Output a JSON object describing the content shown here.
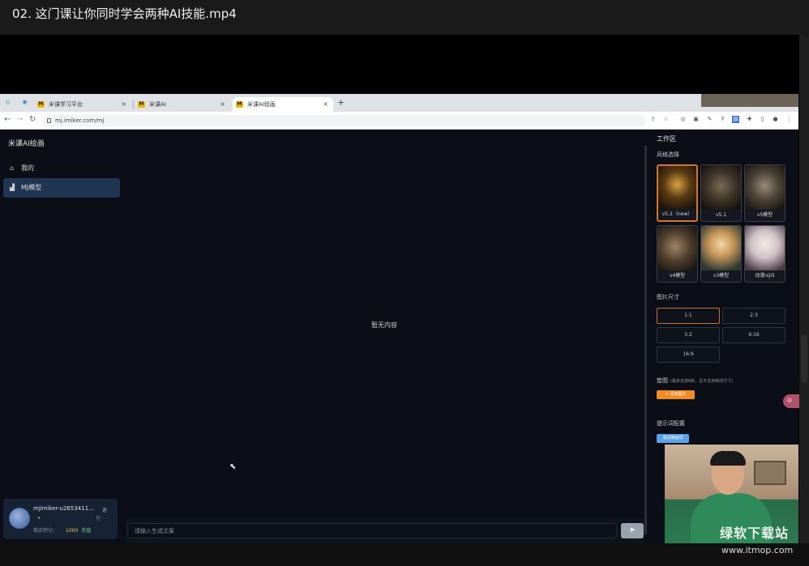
{
  "player": {
    "title": "02. 这门课让你同时学会两种AI技能.mp4"
  },
  "browser": {
    "tabs": [
      {
        "label": "米课学习平台",
        "favicon": "M",
        "close": "×"
      },
      {
        "label": "米课AI",
        "favicon": "M",
        "close": "×"
      },
      {
        "label": "米课AI绘画",
        "favicon": "M",
        "close": "×"
      }
    ],
    "new_tab": "+",
    "url": "mj.imiker.com/mj"
  },
  "app": {
    "title": "米课AI绘画",
    "nav": [
      {
        "label": "我的",
        "icon": "⌂"
      },
      {
        "label": "MJ模型",
        "icon": "▟"
      }
    ],
    "empty_text": "暂无内容",
    "input_placeholder": "请输入生成文案",
    "send_icon": "➤",
    "user": {
      "name": "mjimiker-u2653411...",
      "action": "退",
      "sub1": "◂",
      "sub2": "⎘",
      "points_label": "剩余积分：",
      "points_value": "1000",
      "charge_label": "充值"
    }
  },
  "panel": {
    "title": "工作区",
    "style_label": "风格选择",
    "styles": [
      {
        "label": "v5.2（new）",
        "selected": true
      },
      {
        "label": "v5.1",
        "selected": false
      },
      {
        "label": "v5模型",
        "selected": false
      },
      {
        "label": "v4模型",
        "selected": false
      },
      {
        "label": "v3模型",
        "selected": false
      },
      {
        "label": "动漫niji5",
        "selected": false
      }
    ],
    "size_label": "图片尺寸",
    "sizes": [
      {
        "label": "1:1",
        "selected": true
      },
      {
        "label": "2:3",
        "selected": false
      },
      {
        "label": "3:2",
        "selected": false
      },
      {
        "label": "9:16",
        "selected": false
      },
      {
        "label": "16:9",
        "selected": false
      }
    ],
    "ref_label": "垫图",
    "ref_note": "(最多支持6张，且不支持修改尺寸)",
    "add_button": "+ 添加图片",
    "prompt_label": "提示词配置",
    "prompt_tag": "测试等级词",
    "float_chip": "中"
  },
  "overlay": {
    "watermark": "绿软下载站",
    "watermark_url": "www.itmop.com"
  }
}
